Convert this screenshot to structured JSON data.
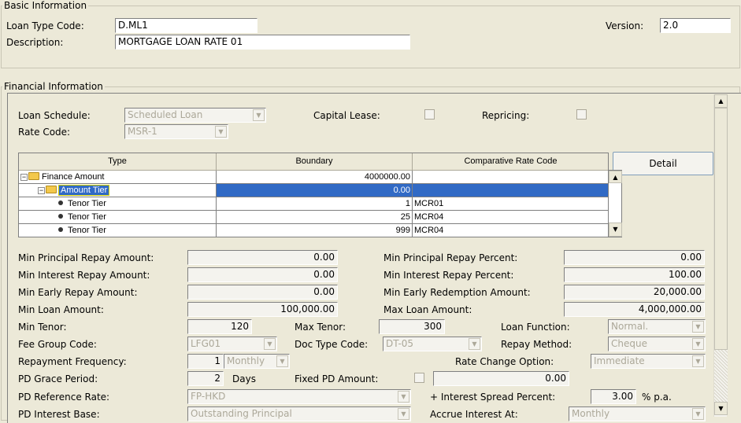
{
  "basic": {
    "title": "Basic Information",
    "loan_type_code_label": "Loan Type Code:",
    "loan_type_code": "D.ML1",
    "description_label": "Description:",
    "description": "MORTGAGE LOAN RATE 01",
    "version_label": "Version:",
    "version": "2.0"
  },
  "financial": {
    "title": "Financial Information",
    "loan_schedule_label": "Loan Schedule:",
    "loan_schedule": "Scheduled Loan",
    "capital_lease_label": "Capital Lease:",
    "repricing_label": "Repricing:",
    "rate_code_label": "Rate Code:",
    "rate_code": "MSR-1",
    "detail_button": "Detail",
    "grid": {
      "headers": [
        "Type",
        "Boundary",
        "Comparative Rate Code"
      ],
      "rows": [
        {
          "type": "Finance Amount",
          "boundary": "4000000.00",
          "rate": ""
        },
        {
          "type": "Amount Tier",
          "boundary": "0.00",
          "rate": ""
        },
        {
          "type": "Tenor Tier",
          "boundary": "1",
          "rate": "MCR01"
        },
        {
          "type": "Tenor Tier",
          "boundary": "25",
          "rate": "MCR04"
        },
        {
          "type": "Tenor Tier",
          "boundary": "999",
          "rate": "MCR04"
        }
      ]
    },
    "min_principal_repay_amount_label": "Min Principal Repay Amount:",
    "min_principal_repay_amount": "0.00",
    "min_principal_repay_percent_label": "Min Principal Repay Percent:",
    "min_principal_repay_percent": "0.00",
    "min_interest_repay_amount_label": "Min Interest Repay Amount:",
    "min_interest_repay_amount": "0.00",
    "min_interest_repay_percent_label": "Min Interest Repay Percent:",
    "min_interest_repay_percent": "100.00",
    "min_early_repay_amount_label": "Min Early Repay Amount:",
    "min_early_repay_amount": "0.00",
    "min_early_redemption_amount_label": "Min Early Redemption Amount:",
    "min_early_redemption_amount": "20,000.00",
    "min_loan_amount_label": "Min Loan Amount:",
    "min_loan_amount": "100,000.00",
    "max_loan_amount_label": "Max Loan Amount:",
    "max_loan_amount": "4,000,000.00",
    "min_tenor_label": "Min Tenor:",
    "min_tenor": "120",
    "max_tenor_label": "Max Tenor:",
    "max_tenor": "300",
    "loan_function_label": "Loan Function:",
    "loan_function": "Normal.",
    "fee_group_code_label": "Fee Group Code:",
    "fee_group_code": "LFG01",
    "doc_type_code_label": "Doc Type Code:",
    "doc_type_code": "DT-05",
    "repay_method_label": "Repay Method:",
    "repay_method": "Cheque",
    "repayment_frequency_label": "Repayment Frequency:",
    "repayment_frequency_num": "1",
    "repayment_frequency_unit": "Monthly",
    "rate_change_option_label": "Rate Change Option:",
    "rate_change_option": "Immediate",
    "pd_grace_period_label": "PD Grace Period:",
    "pd_grace_period": "2",
    "pd_grace_unit": "Days",
    "fixed_pd_amount_label": "Fixed PD Amount:",
    "fixed_pd_amount": "0.00",
    "pd_reference_rate_label": "PD Reference Rate:",
    "pd_reference_rate": "FP-HKD",
    "interest_spread_label": "+ Interest Spread Percent:",
    "interest_spread": "3.00",
    "interest_spread_unit": "% p.a.",
    "pd_interest_base_label": "PD Interest Base:",
    "pd_interest_base": "Outstanding Principal",
    "accrue_interest_at_label": "Accrue Interest At:",
    "accrue_interest_at": "Monthly"
  }
}
